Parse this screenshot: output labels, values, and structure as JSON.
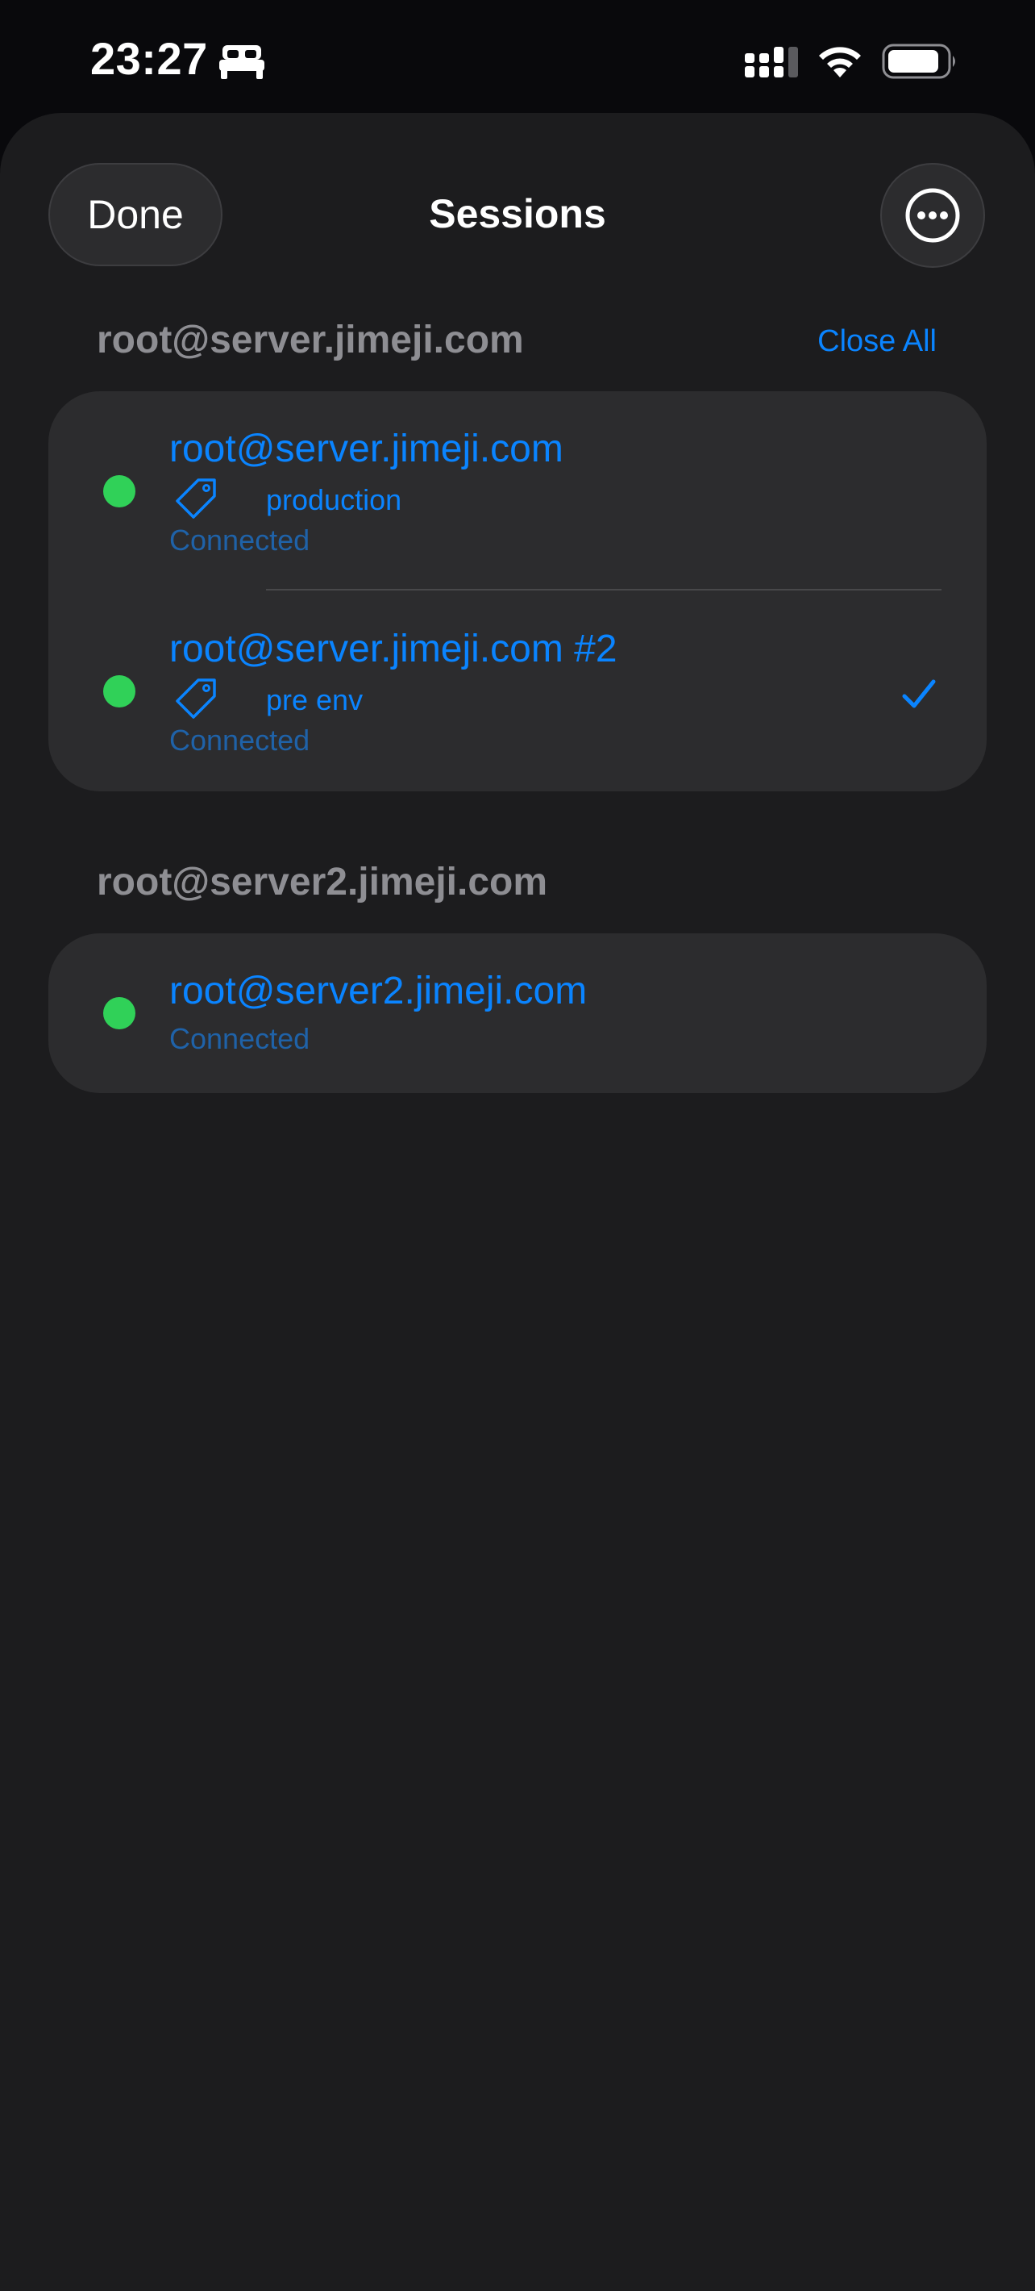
{
  "status_bar": {
    "time": "23:27",
    "focus_icon": "bed-icon",
    "signal_icon": "cellular-signal-icon",
    "wifi_icon": "wifi-icon",
    "battery_icon": "battery-icon"
  },
  "header": {
    "done_label": "Done",
    "title": "Sessions",
    "more_icon": "ellipsis-circle-icon"
  },
  "groups": [
    {
      "title": "root@server.jimeji.com",
      "action_label": "Close All",
      "sessions": [
        {
          "host": "root@server.jimeji.com",
          "tag": "production",
          "status": "Connected",
          "selected": false
        },
        {
          "host": "root@server.jimeji.com #2",
          "tag": "pre env",
          "status": "Connected",
          "selected": true
        }
      ]
    },
    {
      "title": "root@server2.jimeji.com",
      "sessions": [
        {
          "host": "root@server2.jimeji.com",
          "status": "Connected",
          "selected": false
        }
      ]
    }
  ],
  "colors": {
    "accent": "#0a84ff",
    "connected_dot": "#30d158",
    "sheet_background": "#1c1c1e",
    "group_background": "#2c2c2e"
  }
}
